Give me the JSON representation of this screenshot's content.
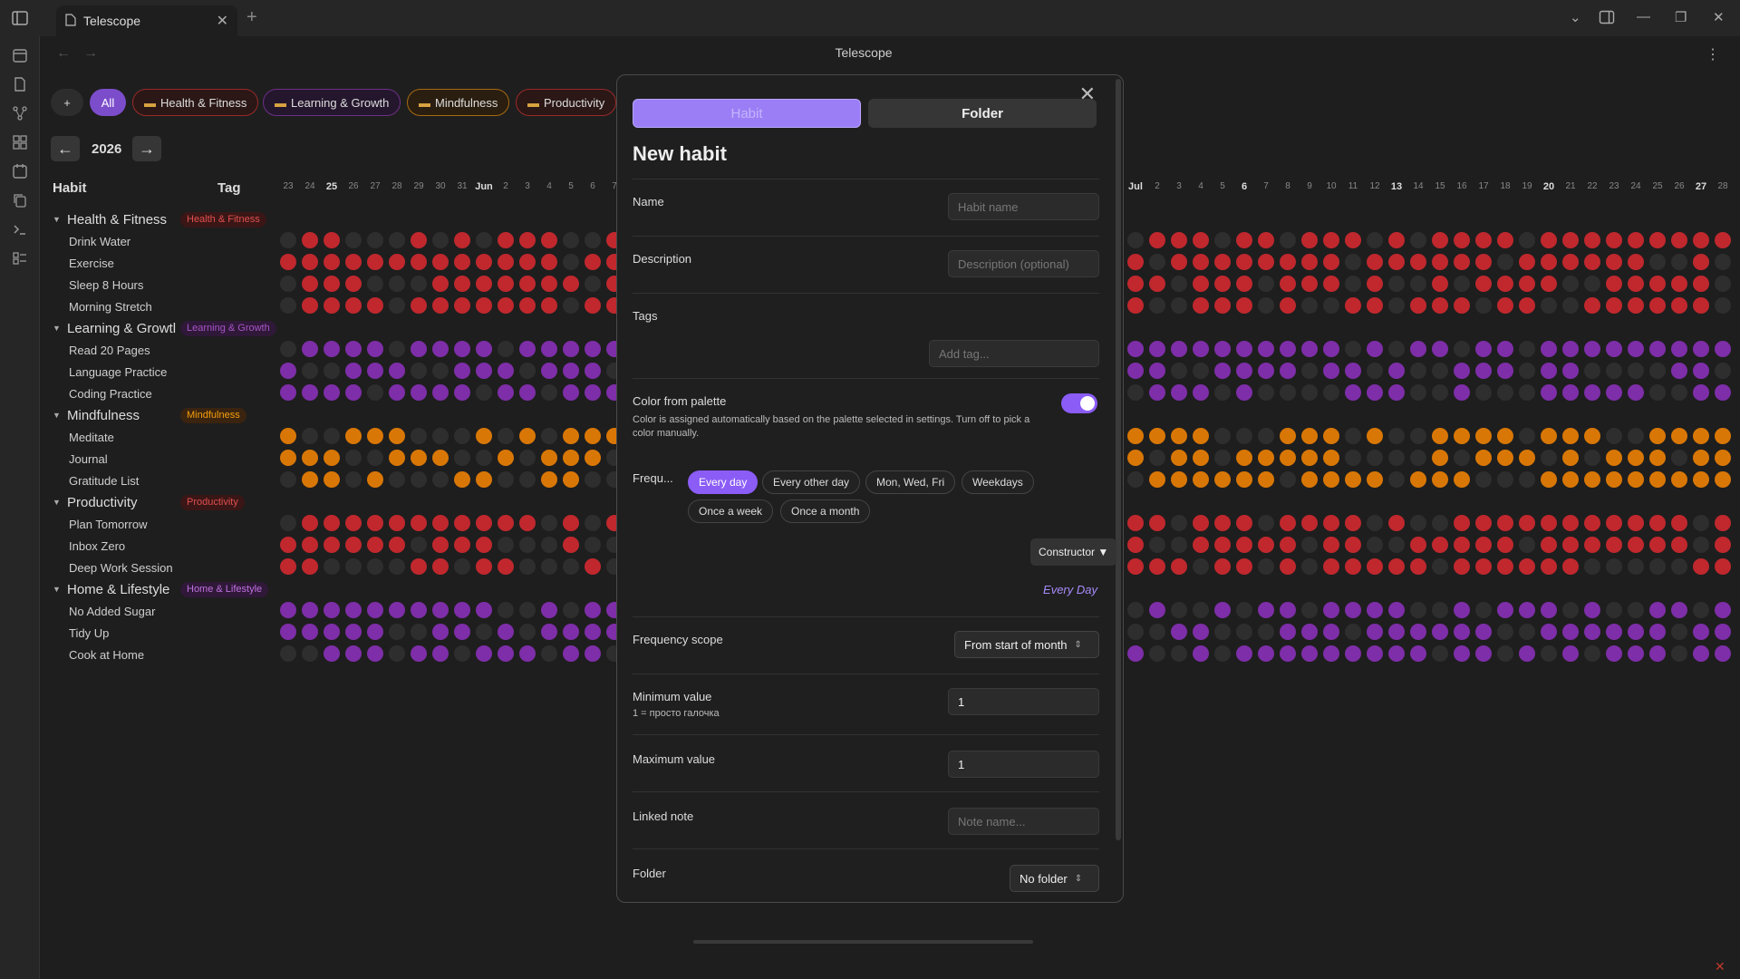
{
  "window": {
    "tab_title": "Telescope",
    "view_title": "Telescope"
  },
  "toolbar": {
    "add_label": "+",
    "filters": [
      "All",
      "Health & Fitness",
      "Learning & Growth",
      "Mindfulness",
      "Productivity"
    ]
  },
  "year": {
    "prev": "←",
    "value": "2026",
    "next": "→"
  },
  "table": {
    "habit_header": "Habit",
    "tag_header": "Tag"
  },
  "colors": {
    "health": "#c0282e",
    "learning": "#7e2ea8",
    "mindfulness": "#d97706",
    "productivity": "#c0282e",
    "home": "#7e2ea8",
    "accent": "#8b5cf6",
    "empty": "#2e2e2e"
  },
  "groups": [
    {
      "name": "Health & Fitness",
      "tag": "Health & Fitness",
      "color_key": "health",
      "habits": [
        "Drink Water",
        "Exercise",
        "Sleep 8 Hours",
        "Morning Stretch"
      ]
    },
    {
      "name": "Learning & Growtl",
      "tag": "Learning & Growth",
      "color_key": "learning",
      "habits": [
        "Read 20 Pages",
        "Language Practice",
        "Coding Practice"
      ]
    },
    {
      "name": "Mindfulness",
      "tag": "Mindfulness",
      "color_key": "mindfulness",
      "habits": [
        "Meditate",
        "Journal",
        "Gratitude List"
      ]
    },
    {
      "name": "Productivity",
      "tag": "Productivity",
      "color_key": "productivity",
      "habits": [
        "Plan Tomorrow",
        "Inbox Zero",
        "Deep Work Session"
      ]
    },
    {
      "name": "Home & Lifestyle",
      "tag": "Home & Lifestyle",
      "color_key": "home",
      "habits": [
        "No Added Sugar",
        "Tidy Up",
        "Cook at Home"
      ]
    }
  ],
  "days_left": [
    "23",
    "24",
    "25",
    "26",
    "27",
    "28",
    "29",
    "30",
    "31",
    "Jun",
    "2",
    "3",
    "4",
    "5",
    "6",
    "7"
  ],
  "days_left_bold": [
    "25",
    "Jun"
  ],
  "days_right": [
    "Jul",
    "2",
    "3",
    "4",
    "5",
    "6",
    "7",
    "8",
    "9",
    "10",
    "11",
    "12",
    "13",
    "14",
    "15",
    "16",
    "17",
    "18",
    "19",
    "20",
    "21",
    "22",
    "23",
    "24",
    "25",
    "26",
    "27",
    "28"
  ],
  "days_right_bold": [
    "Jul",
    "6",
    "13",
    "20",
    "27"
  ],
  "modal": {
    "close": "✕",
    "tab_habit": "Habit",
    "tab_folder": "Folder",
    "title": "New habit",
    "name_label": "Name",
    "name_placeholder": "Habit name",
    "description_label": "Description",
    "description_placeholder": "Description (optional)",
    "tags_label": "Tags",
    "tags_placeholder": "Add tag...",
    "color_label": "Color from palette",
    "color_desc": "Color is assigned automatically based on the palette selected in settings. Turn off to pick a color manually.",
    "color_toggle_on": true,
    "frequency_label": "Frequ...",
    "frequency_options": [
      "Every day",
      "Every other day",
      "Mon, Wed, Fri",
      "Weekdays",
      "Once a week",
      "Once a month"
    ],
    "frequency_selected": "Every day",
    "constructor_label": "Constructor ▼",
    "frequency_summary": "Every Day",
    "scope_label": "Frequency scope",
    "scope_value": "From start of month",
    "min_label": "Minimum value",
    "min_desc": "1 = просто галочка",
    "min_value": "1",
    "max_label": "Maximum value",
    "max_value": "1",
    "note_label": "Linked note",
    "note_placeholder": "Note name...",
    "folder_label": "Folder",
    "folder_value": "No folder"
  }
}
